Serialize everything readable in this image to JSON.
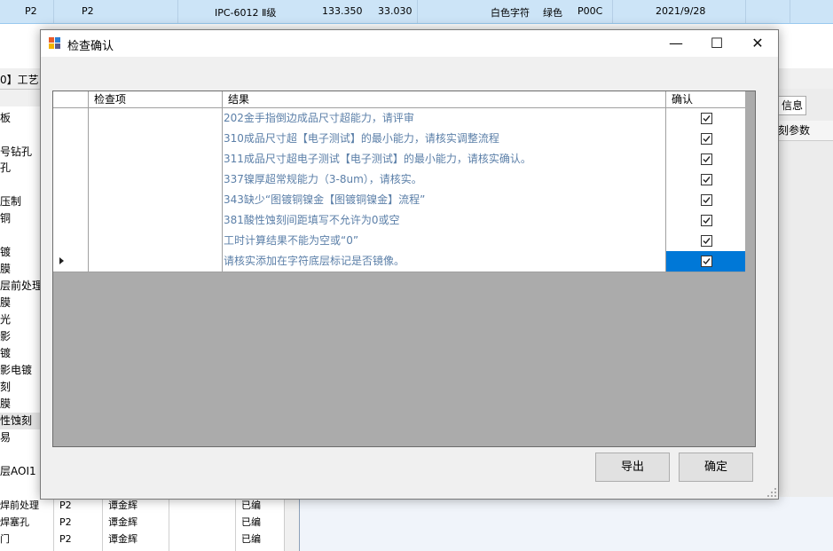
{
  "background": {
    "top_row": [
      "P2",
      "P2",
      "IPC-6012 Ⅱ级",
      "133.350",
      "33.030",
      "白色字符",
      "绿色",
      "P00C",
      "2021/9/28"
    ],
    "left_header": "0】工艺",
    "left_items": [
      "板",
      "",
      "号钻孔",
      "孔",
      "",
      "压制",
      "铜",
      "",
      "镀",
      "膜",
      "层前处理",
      "膜",
      "光",
      "影",
      "镀",
      "影电镀",
      "刻",
      "膜",
      "性蚀刻",
      "易",
      "",
      "层AOI1"
    ],
    "bottom_rows": [
      {
        "name": "焊前处理",
        "level": "P2",
        "person": "谭金辉",
        "status": "已编"
      },
      {
        "name": "焊塞孔",
        "level": "P2",
        "person": "谭金辉",
        "status": "已编"
      },
      {
        "name": "门",
        "level": "P2",
        "person": "谭金辉",
        "status": "已编"
      }
    ],
    "right_tab": "信息",
    "right_params": "刻参数"
  },
  "dialog": {
    "title": "检查确认",
    "minimize_glyph": "—",
    "maximize_glyph": "☐",
    "close_glyph": "✕",
    "columns": {
      "item": "检查项",
      "result": "结果",
      "confirm": "确认"
    },
    "rows": [
      {
        "item": "",
        "result": "202金手指倒边成品尺寸超能力，请评审",
        "confirmed": true
      },
      {
        "item": "",
        "result": "310成品尺寸超【电子测试】的最小能力，请核实调整流程",
        "confirmed": true
      },
      {
        "item": "",
        "result": "311成品尺寸超电子测试【电子测试】的最小能力，请核实确认。",
        "confirmed": true
      },
      {
        "item": "",
        "result": "337镍厚超常规能力（3-8um），请核实。",
        "confirmed": true
      },
      {
        "item": "",
        "result": "343缺少“图镀铜镍金【图镀铜镍金】流程”",
        "confirmed": true
      },
      {
        "item": "",
        "result": "381酸性蚀刻间距填写不允许为0或空",
        "confirmed": true
      },
      {
        "item": "",
        "result": "工时计算结果不能为空或“0”",
        "confirmed": true
      },
      {
        "item": "",
        "result": "请核实添加在字符底层标记是否镜像。",
        "confirmed": true
      }
    ],
    "export_label": "导出",
    "ok_label": "确定"
  },
  "colors": {
    "selection": "#0078d7",
    "result_text": "#5b7fa8",
    "grid_empty": "#ababab",
    "top_row_highlight": "#cce4f7"
  }
}
